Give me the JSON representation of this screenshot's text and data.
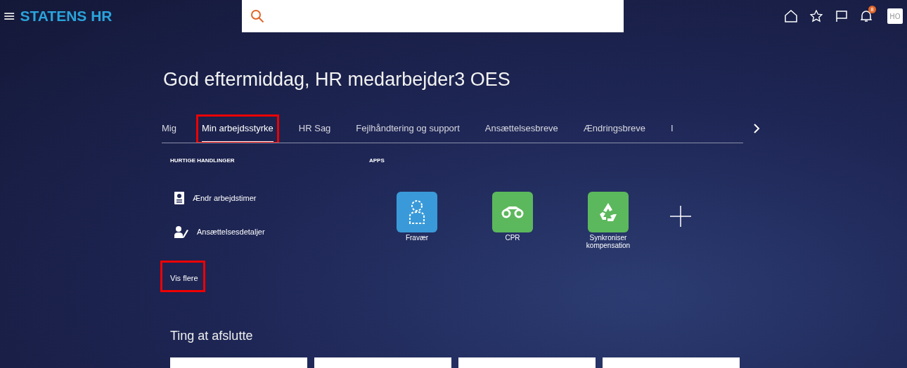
{
  "header": {
    "logo": "STATENS HR",
    "menu_icon": "≡",
    "badge_count": "8",
    "avatar": "HO"
  },
  "greeting": "God eftermiddag, HR medarbejder3 OES",
  "tabs": [
    {
      "label": "Mig",
      "selected": false,
      "highlighted": false
    },
    {
      "label": "Min arbejdsstyrke",
      "selected": true,
      "highlighted": true
    },
    {
      "label": "HR Sag",
      "selected": false,
      "highlighted": false
    },
    {
      "label": "Fejlhåndtering og support",
      "selected": false,
      "highlighted": false
    },
    {
      "label": "Ansættelsesbreve",
      "selected": false,
      "highlighted": false
    },
    {
      "label": "Ændringsbreve",
      "selected": false,
      "highlighted": false
    },
    {
      "label": "I",
      "selected": false,
      "highlighted": false
    }
  ],
  "quick_actions": {
    "title": "HURTIGE HANDLINGER",
    "items": [
      {
        "label": "Ændr arbejdstimer",
        "kind": "badge"
      },
      {
        "label": "Ansættelsesdetaljer",
        "kind": "person-edit"
      }
    ],
    "more": {
      "label": "Vis flere",
      "highlighted": true
    }
  },
  "apps": {
    "title": "APPS",
    "items": [
      {
        "label": "Fravær",
        "kind": "person",
        "color": "#3a9ad9"
      },
      {
        "label": "CPR",
        "kind": "binoculars",
        "color": "#5cb85c"
      },
      {
        "label": "Synkroniser kompensation",
        "kind": "recycle",
        "color": "#5cb85c"
      }
    ]
  },
  "todo": {
    "title": "Ting at afslutte"
  }
}
